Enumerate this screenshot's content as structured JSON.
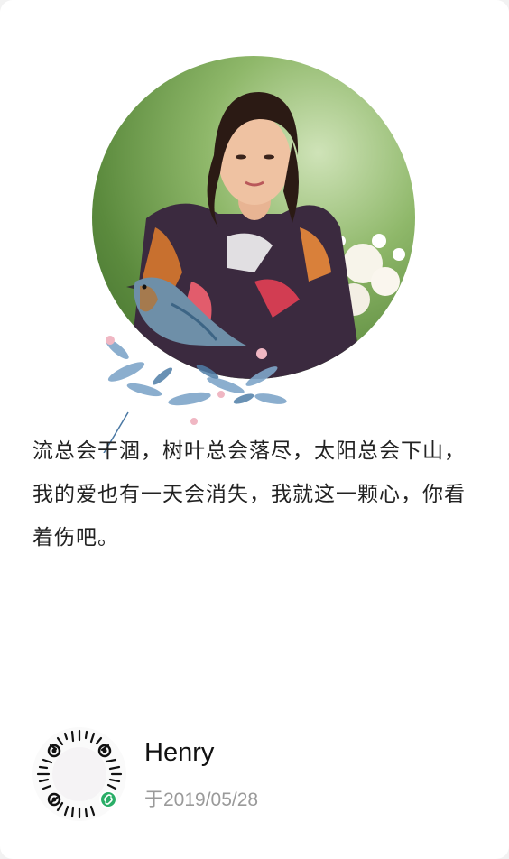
{
  "poem": {
    "text": "流总会干涸，树叶总会落尽，太阳总会下山，我的爱也有一天会消失，我就这一颗心，你看着伤吧。"
  },
  "author": {
    "name": "Henry",
    "date": "于2019/05/28"
  },
  "images": {
    "photo": "portrait-woman-scarf-flowers",
    "decoration": "bird-on-floral-branch",
    "qr_code": "wechat-mini-program-code",
    "badge": "wechat-mini-program-icon"
  },
  "colors": {
    "background": "#ffffff",
    "text": "#222222",
    "date": "#9a9a9a",
    "badge": "#2aae67"
  }
}
